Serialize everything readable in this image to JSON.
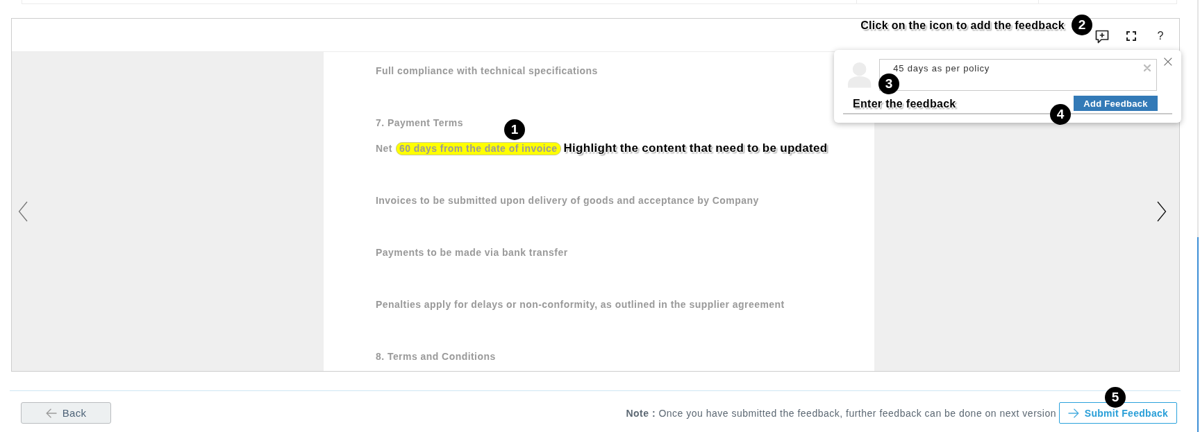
{
  "toolbar": {
    "callout": "Click on the icon to add the feedback",
    "help": "?"
  },
  "document": {
    "paragraphs": [
      {
        "kind": "text",
        "text": "Full compliance with technical specifications"
      },
      {
        "kind": "heading",
        "text": "7. Payment Terms"
      },
      {
        "kind": "highlight",
        "text": "Net",
        "highlight": "60 days from the date of invoice",
        "callout": "Highlight the content that need to be updated"
      },
      {
        "kind": "text",
        "text": "Invoices to be submitted upon delivery of goods and acceptance by Company"
      },
      {
        "kind": "text",
        "text": "Payments to be made via bank transfer"
      },
      {
        "kind": "text",
        "text": "Penalties apply for delays or non-conformity, as outlined in the supplier agreement"
      },
      {
        "kind": "heading",
        "text": "8. Terms and Conditions"
      }
    ]
  },
  "feedback_popup": {
    "value": "45 days as per policy",
    "callout": "Enter the feedback",
    "button": "Add Feedback"
  },
  "footer": {
    "back_button": "Back",
    "note": "**Note :** Once you have submitted the feedback, further feedback can be done on next version",
    "submit_button": "Submit Feedback"
  },
  "step_badges": [
    "1",
    "2",
    "3",
    "4",
    "5"
  ]
}
